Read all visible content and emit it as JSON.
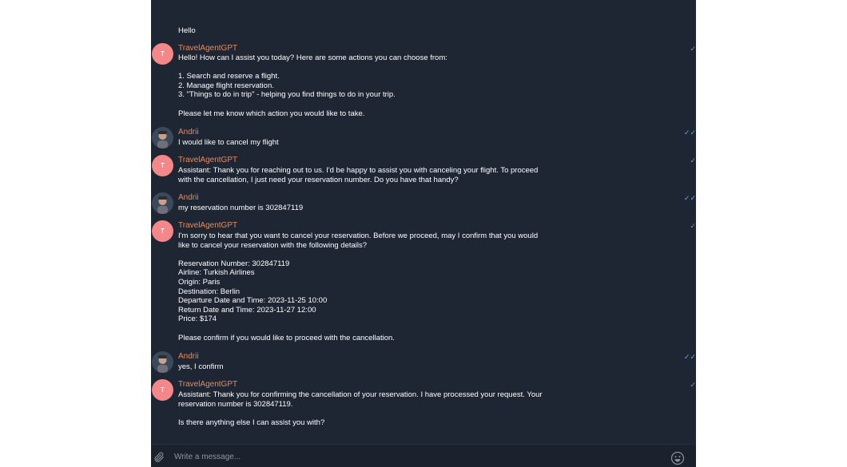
{
  "conversation": {
    "first_message": "Hello",
    "messages": [
      {
        "sender": "TravelAgentGPT",
        "avatar_letter": "T",
        "text": "Hello! How can I assist you today? Here are some actions you can choose from:\n\n1. Search and reserve a flight.\n2. Manage flight reservation.\n3. \"Things to do in trip\" - helping you find things to do in your trip.\n\nPlease let me know which action you would like to take."
      },
      {
        "sender": "Andrii",
        "text": "I would like to cancel my flight"
      },
      {
        "sender": "TravelAgentGPT",
        "avatar_letter": "T",
        "text": "Assistant: Thank you for reaching out to us. I'd be happy to assist you with canceling your flight. To proceed\nwith the cancellation, I just need your reservation number. Do you have that handy?"
      },
      {
        "sender": "Andrii",
        "text": "my reservation number is 302847119"
      },
      {
        "sender": "TravelAgentGPT",
        "avatar_letter": "T",
        "text": "I'm sorry to hear that you want to cancel your reservation. Before we proceed, may I confirm that you would\nlike to cancel your reservation with the following details?\n\nReservation Number: 302847119\nAirline: Turkish Airlines\nOrigin: Paris\nDestination: Berlin\nDeparture Date and Time: 2023-11-25 10:00\nReturn Date and Time: 2023-11-27 12:00\nPrice: $174\n\nPlease confirm if you would like to proceed with the cancellation."
      },
      {
        "sender": "Andrii",
        "text": "yes, I confirm"
      },
      {
        "sender": "TravelAgentGPT",
        "avatar_letter": "T",
        "text": "Assistant: Thank you for confirming the cancellation of your reservation. I have processed your request. Your\nreservation number is 302847119.\n\nIs there anything else I can assist you with?"
      }
    ]
  },
  "composer": {
    "placeholder": "Write a message..."
  },
  "icons": {
    "attach": "paperclip-icon",
    "emoji": "smiley-icon",
    "read": "double-check-icon"
  },
  "colors": {
    "chat_background": "#1e2633",
    "sender_name": "#e88a5a",
    "bot_avatar": "#f2888a",
    "read_tick": "#5fa8e8"
  }
}
